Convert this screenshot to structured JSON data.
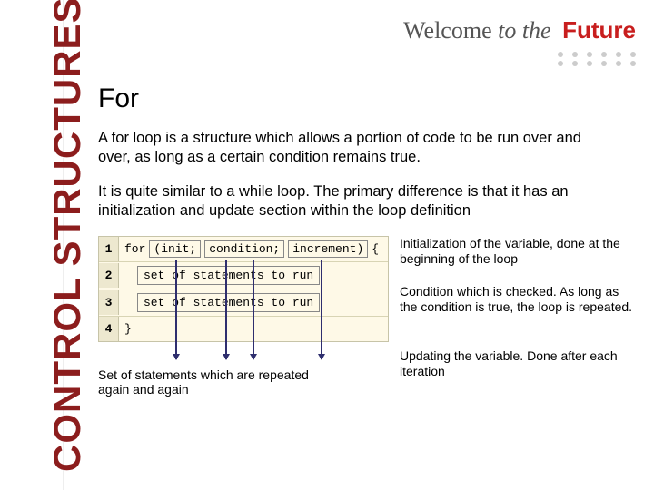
{
  "sidebar": {
    "label": "CONTROL STRUCTURES"
  },
  "header": {
    "welcome": "Welcome",
    "to_the": " to the ",
    "future": "Future"
  },
  "title": "For",
  "para1": "A for loop is a structure which allows a portion of code to be run over and over, as long as a certain condition remains true.",
  "para2": "It is quite similar to a while loop. The primary difference is that it has an initialization and update section within the loop definition",
  "code": {
    "ln1": "1",
    "ln2": "2",
    "ln3": "3",
    "ln4": "4",
    "kw_for": "for",
    "init": "(init;",
    "cond": "condition;",
    "incr": "increment)",
    "brace_open": " {",
    "stmt": "set of statements to run",
    "brace_close": "}"
  },
  "notes": {
    "init": "Initialization of the variable, done at the beginning of the loop",
    "cond": "Condition which is checked. As long as the condition is true, the loop is repeated.",
    "update": "Updating the variable. Done after each iteration",
    "stmts": "Set of statements which are repeated again and again"
  }
}
